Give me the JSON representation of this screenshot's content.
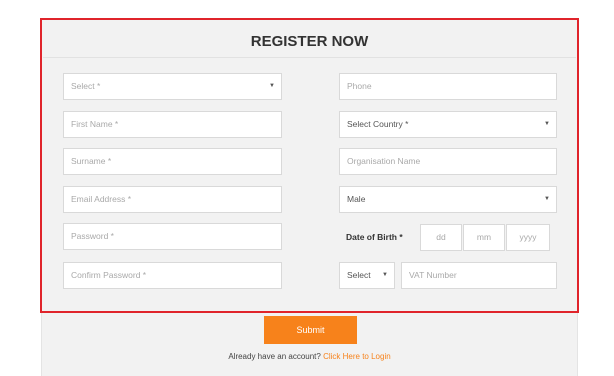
{
  "form": {
    "title": "REGISTER NOW",
    "left_fields": [
      {
        "placeholder": "Select *",
        "kind": "select"
      },
      {
        "placeholder": "First Name *",
        "kind": "input"
      },
      {
        "placeholder": "Surname *",
        "kind": "input"
      },
      {
        "placeholder": "Email Address *",
        "kind": "input"
      },
      {
        "placeholder": "Password *",
        "kind": "input"
      },
      {
        "placeholder": "Confirm Password *",
        "kind": "input"
      }
    ],
    "phone_placeholder": "Phone",
    "country_select": "Select Country *",
    "organisation_placeholder": "Organisation Name",
    "gender_select": "Male",
    "dob": {
      "label": "Date of Birth *",
      "day_placeholder": "dd",
      "month_placeholder": "mm",
      "year_placeholder": "yyyy"
    },
    "vat_prefix_select": "Select",
    "vat_placeholder": "VAT Number",
    "submit_label": "Submit",
    "login_prompt": "Already have an account?",
    "login_link": "Click Here to Login"
  },
  "colors": {
    "highlight_border": "#e0242b",
    "accent": "#f7821b",
    "panel_bg": "#f2f2f2"
  },
  "icons": {
    "caret": "chevron-down-icon"
  }
}
